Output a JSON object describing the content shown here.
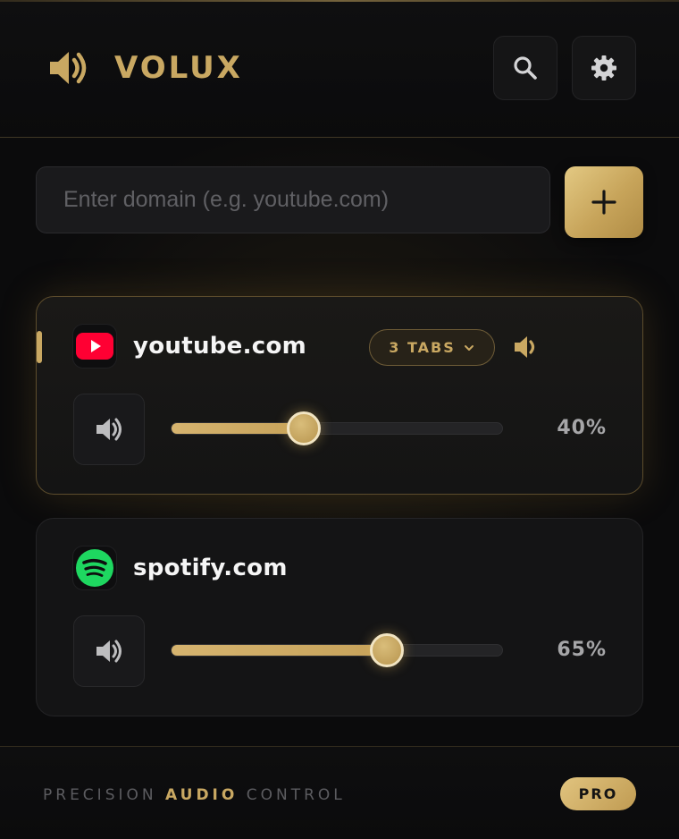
{
  "header": {
    "brand_icon": "speaker-icon",
    "brand_name": "VOLUX",
    "search_icon": "search-icon",
    "settings_icon": "gear-icon"
  },
  "domain_input": {
    "placeholder": "Enter domain (e.g. youtube.com)",
    "value": "",
    "add_icon": "plus-icon"
  },
  "sites": [
    {
      "domain": "youtube.com",
      "icon": "youtube-icon",
      "icon_color": "#ff0033",
      "active": true,
      "tabs_label": "3 TABS",
      "tabs_icon": "chevron-down-icon",
      "volume": 40,
      "volume_label": "40%"
    },
    {
      "domain": "spotify.com",
      "icon": "spotify-icon",
      "icon_color": "#1ed760",
      "active": false,
      "volume": 65,
      "volume_label": "65%"
    }
  ],
  "footer": {
    "tag_part1": "PRECISION ",
    "tag_accent": "AUDIO",
    "tag_part2": " CONTROL",
    "badge": "PRO"
  },
  "colors": {
    "accent_gold": "#c9a862",
    "background": "#0b0b0c",
    "card": "#141415"
  }
}
